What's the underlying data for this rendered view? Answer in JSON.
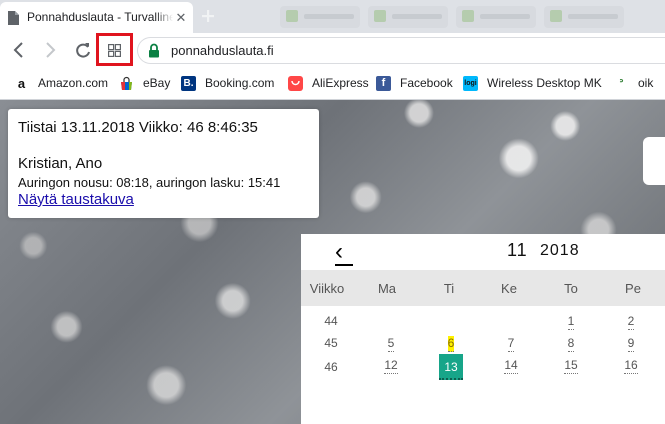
{
  "browser": {
    "tab_title": "Ponnahduslauta - Turvallinen",
    "tab_close": "✕",
    "url": "ponnahduslauta.fi"
  },
  "bookmarks": [
    {
      "label": "Amazon.com",
      "icon": "amazon-icon",
      "glyph": "a",
      "color": "#111111"
    },
    {
      "label": "eBay",
      "icon": "ebay-icon",
      "glyph": "",
      "color": "#e53238"
    },
    {
      "label": "Booking.com",
      "icon": "booking-icon",
      "glyph": "B.",
      "color": "#003580"
    },
    {
      "label": "AliExpress",
      "icon": "aliexpress-icon",
      "glyph": "",
      "color": "#ff4747"
    },
    {
      "label": "Facebook",
      "icon": "facebook-icon",
      "glyph": "f",
      "color": "#3b5998"
    },
    {
      "label": "Wireless Desktop MK",
      "icon": "logitech-icon",
      "glyph": "logi",
      "color": "#00b8fc"
    },
    {
      "label": "oik",
      "icon": "oik-icon",
      "glyph": "ᐣ",
      "color": "#2e7d32"
    }
  ],
  "info": {
    "datetime": "Tiistai 13.11.2018 Viikko: 46 8:46:35",
    "names": "Kristian, Ano",
    "sun": "Auringon nousu: 08:18, auringon lasku: 15:41",
    "background_link": "Näytä taustakuva"
  },
  "calendar": {
    "prev": "‹",
    "month": "11",
    "year": "2018",
    "headers": [
      "Viikko",
      "Ma",
      "Ti",
      "Ke",
      "To",
      "Pe"
    ],
    "weeks": [
      {
        "week": "44",
        "days": [
          "",
          "",
          "",
          "1",
          "2"
        ]
      },
      {
        "week": "45",
        "days": [
          "5",
          "6",
          "7",
          "8",
          "9"
        ]
      },
      {
        "week": "46",
        "days": [
          "12",
          "13",
          "14",
          "15",
          "16"
        ]
      }
    ],
    "holiday": "6",
    "today": "13",
    "today_color": "#17a589",
    "holiday_color": "#fff200"
  }
}
